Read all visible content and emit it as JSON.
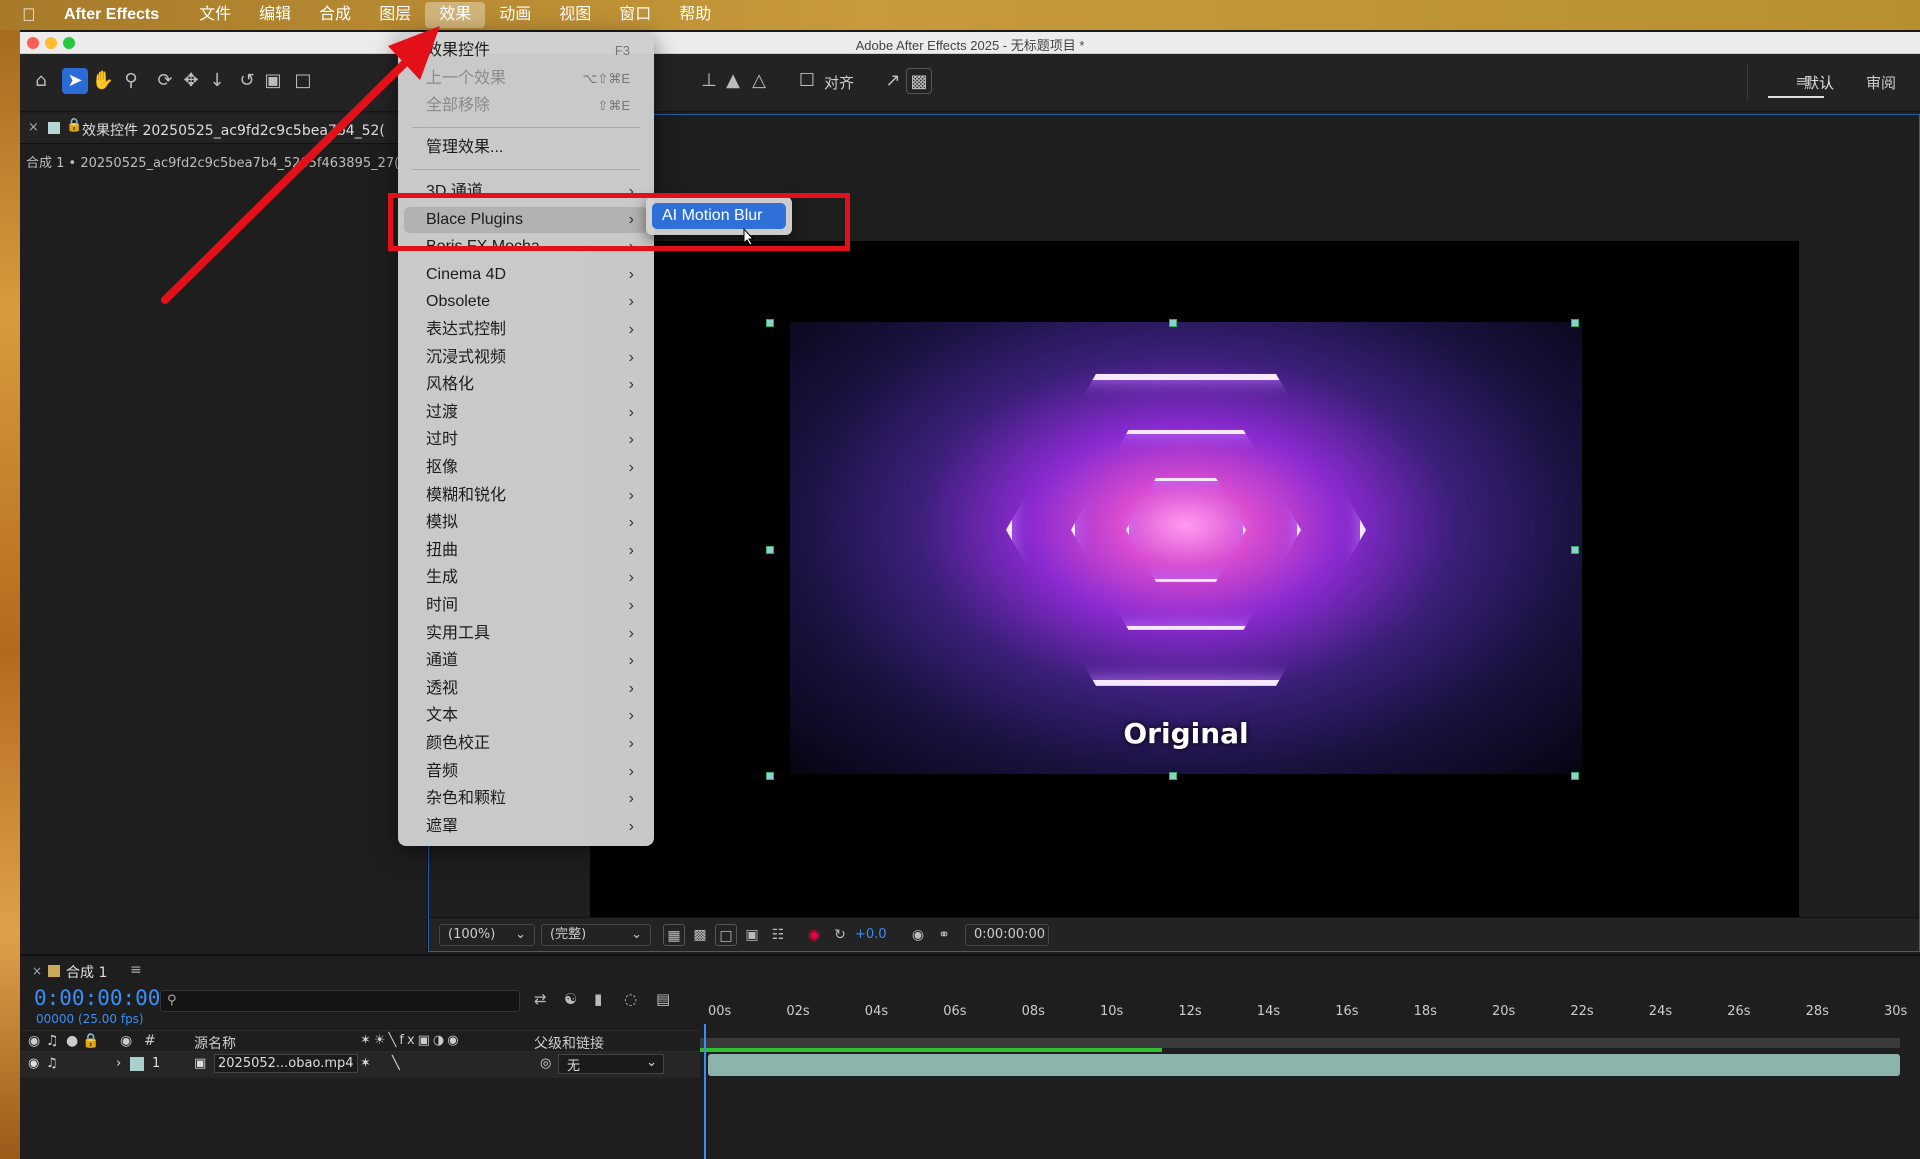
{
  "menubar": {
    "app_name": "After Effects",
    "items": [
      "文件",
      "编辑",
      "合成",
      "图层",
      "效果",
      "动画",
      "视图",
      "窗口",
      "帮助"
    ],
    "active_index": 4
  },
  "window": {
    "title": "Adobe After Effects 2025 - 无标题项目 *"
  },
  "toolbar": {
    "align_label": "对齐",
    "workspace_default": "默认",
    "workspace_review": "审阅"
  },
  "effects_panel": {
    "tab_label": "效果控件 20250525_ac9fd2c9c5bea7b4_52(",
    "path": "合成 1 • 20250525_ac9fd2c9c5bea7b4_5205f463895_27("
  },
  "effect_menu": {
    "top_items": [
      {
        "label": "效果控件",
        "shortcut": "F3",
        "disabled": false
      },
      {
        "label": "上一个效果",
        "shortcut": "⌥⇧⌘E",
        "disabled": true
      },
      {
        "label": "全部移除",
        "shortcut": "⇧⌘E",
        "disabled": true
      }
    ],
    "manage_label": "管理效果...",
    "categories": [
      "3D 通道",
      "Blace Plugins",
      "Boris FX Mocha",
      "Cinema 4D",
      "Obsolete",
      "表达式控制",
      "沉浸式视频",
      "风格化",
      "过渡",
      "过时",
      "抠像",
      "模糊和锐化",
      "模拟",
      "扭曲",
      "生成",
      "时间",
      "实用工具",
      "通道",
      "透视",
      "文本",
      "颜色校正",
      "音频",
      "杂色和颗粒",
      "遮罩"
    ],
    "highlighted_category": "Blace Plugins",
    "submenu_item": "AI Motion Blur"
  },
  "viewer": {
    "caption": "Original",
    "zoom": "(100%)",
    "resolution": "(完整)",
    "exposure": "+0.0",
    "timecode": "0:00:00:00"
  },
  "timeline": {
    "tab_label": "合成 1",
    "time": "0:00:00:00",
    "fps": "00000 (25.00 fps)",
    "col_number": "#",
    "col_source": "源名称",
    "col_parent": "父级和链接",
    "layer": {
      "index": "1",
      "name": "2025052...obao.mp4",
      "parent": "无"
    },
    "ruler_ticks": [
      "00s",
      "02s",
      "04s",
      "06s",
      "08s",
      "10s",
      "12s",
      "14s",
      "16s",
      "18s",
      "20s",
      "22s",
      "24s",
      "26s",
      "28s",
      "30s"
    ]
  },
  "colors": {
    "accent_blue": "#3a8ef5",
    "selection_blue": "#2f6fd8",
    "annotation_red": "#e3101a"
  }
}
